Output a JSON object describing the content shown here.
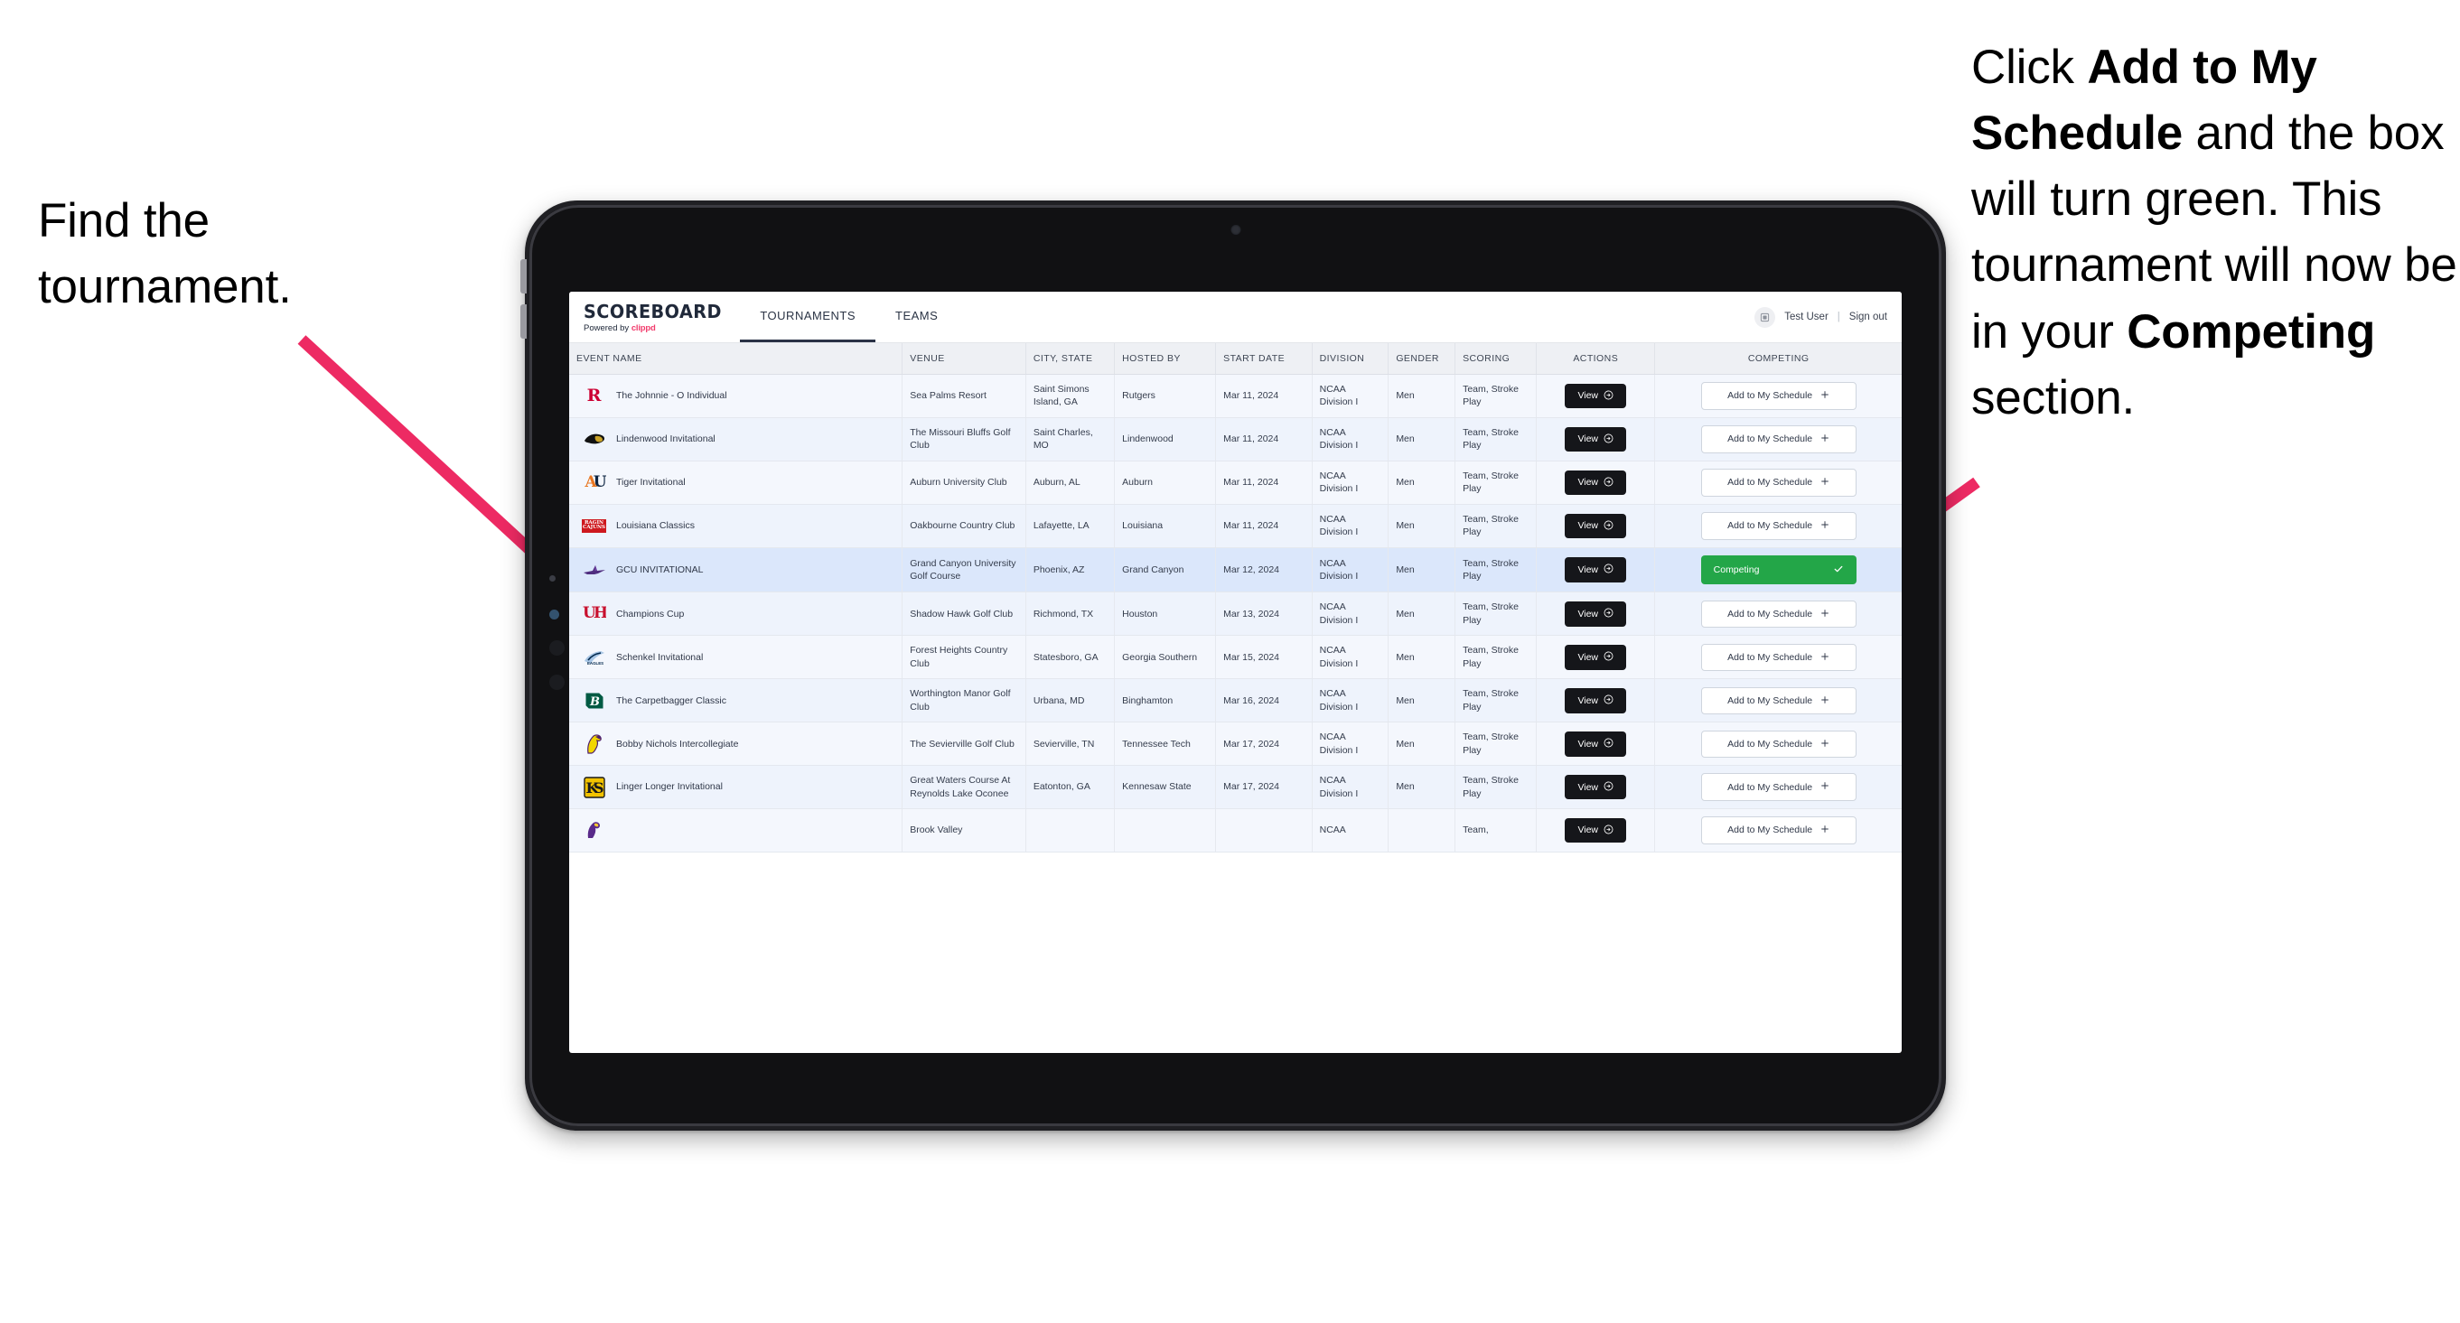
{
  "annotations": {
    "left": "Find the tournament.",
    "right_parts": [
      {
        "t": "Click ",
        "b": false
      },
      {
        "t": "Add to My Schedule",
        "b": true
      },
      {
        "t": " and the box will turn green. This tournament will now be in your ",
        "b": false
      },
      {
        "t": "Competing",
        "b": true
      },
      {
        "t": " section.",
        "b": false
      }
    ],
    "arrow_color": "#ED2A63"
  },
  "app": {
    "brand": {
      "title": "SCOREBOARD",
      "powered_prefix": "Powered by ",
      "powered_name": "clippd"
    },
    "nav": [
      {
        "label": "TOURNAMENTS",
        "active": true
      },
      {
        "label": "TEAMS",
        "active": false
      }
    ],
    "header_right": {
      "avatar_icon": "user-avatar-icon",
      "user": "Test User",
      "separator": "|",
      "signout": "Sign out"
    },
    "colors": {
      "accent_green": "#23A648",
      "dark": "#15161A",
      "selected_row": "#DBE7FB"
    },
    "table": {
      "columns": [
        "EVENT NAME",
        "VENUE",
        "CITY, STATE",
        "HOSTED BY",
        "START DATE",
        "DIVISION",
        "GENDER",
        "SCORING",
        "ACTIONS",
        "COMPETING"
      ],
      "view_label": "View",
      "add_label": "Add to My Schedule",
      "competing_label": "Competing",
      "rows": [
        {
          "logo": "rutgers-logo",
          "event": "The Johnnie - O Individual",
          "venue": "Sea Palms Resort",
          "city": "Saint Simons Island, GA",
          "hosted_by": "Rutgers",
          "start_date": "Mar 11, 2024",
          "division": "NCAA Division I",
          "gender": "Men",
          "scoring": "Team, Stroke Play",
          "competing": false,
          "selected": false
        },
        {
          "logo": "lindenwood-logo",
          "event": "Lindenwood Invitational",
          "venue": "The Missouri Bluffs Golf Club",
          "city": "Saint Charles, MO",
          "hosted_by": "Lindenwood",
          "start_date": "Mar 11, 2024",
          "division": "NCAA Division I",
          "gender": "Men",
          "scoring": "Team, Stroke Play",
          "competing": false,
          "selected": false
        },
        {
          "logo": "auburn-logo",
          "event": "Tiger Invitational",
          "venue": "Auburn University Club",
          "city": "Auburn, AL",
          "hosted_by": "Auburn",
          "start_date": "Mar 11, 2024",
          "division": "NCAA Division I",
          "gender": "Men",
          "scoring": "Team, Stroke Play",
          "competing": false,
          "selected": false
        },
        {
          "logo": "louisiana-logo",
          "event": "Louisiana Classics",
          "venue": "Oakbourne Country Club",
          "city": "Lafayette, LA",
          "hosted_by": "Louisiana",
          "start_date": "Mar 11, 2024",
          "division": "NCAA Division I",
          "gender": "Men",
          "scoring": "Team, Stroke Play",
          "competing": false,
          "selected": false
        },
        {
          "logo": "gcu-logo",
          "event": "GCU INVITATIONAL",
          "venue": "Grand Canyon University Golf Course",
          "city": "Phoenix, AZ",
          "hosted_by": "Grand Canyon",
          "start_date": "Mar 12, 2024",
          "division": "NCAA Division I",
          "gender": "Men",
          "scoring": "Team, Stroke Play",
          "competing": true,
          "selected": true
        },
        {
          "logo": "houston-logo",
          "event": "Champions Cup",
          "venue": "Shadow Hawk Golf Club",
          "city": "Richmond, TX",
          "hosted_by": "Houston",
          "start_date": "Mar 13, 2024",
          "division": "NCAA Division I",
          "gender": "Men",
          "scoring": "Team, Stroke Play",
          "competing": false,
          "selected": false
        },
        {
          "logo": "georgia-southern-logo",
          "event": "Schenkel Invitational",
          "venue": "Forest Heights Country Club",
          "city": "Statesboro, GA",
          "hosted_by": "Georgia Southern",
          "start_date": "Mar 15, 2024",
          "division": "NCAA Division I",
          "gender": "Men",
          "scoring": "Team, Stroke Play",
          "competing": false,
          "selected": false
        },
        {
          "logo": "binghamton-logo",
          "event": "The Carpetbagger Classic",
          "venue": "Worthington Manor Golf Club",
          "city": "Urbana, MD",
          "hosted_by": "Binghamton",
          "start_date": "Mar 16, 2024",
          "division": "NCAA Division I",
          "gender": "Men",
          "scoring": "Team, Stroke Play",
          "competing": false,
          "selected": false
        },
        {
          "logo": "tennessee-tech-logo",
          "event": "Bobby Nichols Intercollegiate",
          "venue": "The Sevierville Golf Club",
          "city": "Sevierville, TN",
          "hosted_by": "Tennessee Tech",
          "start_date": "Mar 17, 2024",
          "division": "NCAA Division I",
          "gender": "Men",
          "scoring": "Team, Stroke Play",
          "competing": false,
          "selected": false
        },
        {
          "logo": "kennesaw-state-logo",
          "event": "Linger Longer Invitational",
          "venue": "Great Waters Course At Reynolds Lake Oconee",
          "city": "Eatonton, GA",
          "hosted_by": "Kennesaw State",
          "start_date": "Mar 17, 2024",
          "division": "NCAA Division I",
          "gender": "Men",
          "scoring": "Team, Stroke Play",
          "competing": false,
          "selected": false
        },
        {
          "logo": "east-carolina-logo",
          "event": "",
          "venue": "Brook Valley",
          "city": "",
          "hosted_by": "",
          "start_date": "",
          "division": "NCAA",
          "gender": "",
          "scoring": "Team,",
          "competing": false,
          "selected": false
        }
      ]
    }
  }
}
